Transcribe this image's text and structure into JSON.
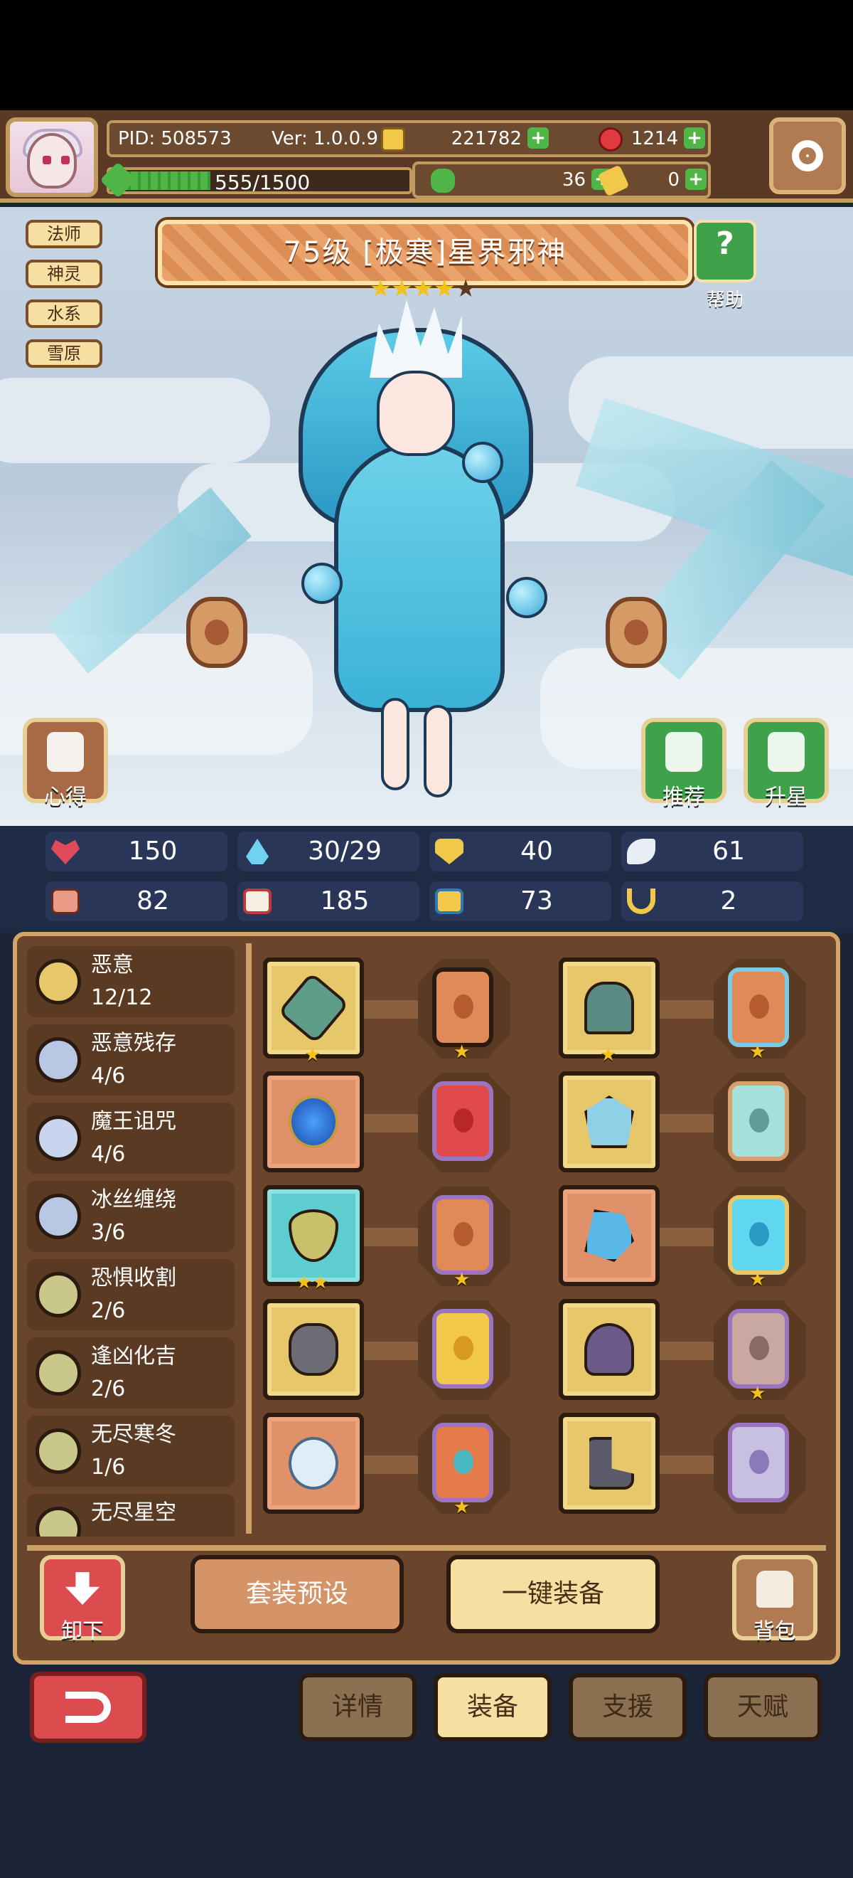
{
  "header": {
    "pid": "PID: 508573",
    "version": "Ver: 1.0.0.9",
    "gold": "221782",
    "gems": "1214",
    "xp": "555/1500",
    "clover": "36",
    "scroll": "0"
  },
  "hero": {
    "tags": [
      "法师",
      "神灵",
      "水系",
      "雪原"
    ],
    "title": "75级  [极寒]星界邪神",
    "stars_filled": 4,
    "stars_total": 5,
    "help_label": "帮助",
    "insight_label": "心得",
    "recommend_label": "推荐",
    "upgrade_label": "升星"
  },
  "stats": [
    {
      "icon": "heart-icon",
      "value": "150"
    },
    {
      "icon": "mana-drop-icon",
      "value": "30/29"
    },
    {
      "icon": "shield-icon",
      "value": "40"
    },
    {
      "icon": "wing-icon",
      "value": "61"
    },
    {
      "icon": "fist-icon",
      "value": "82"
    },
    {
      "icon": "spellbook-icon",
      "value": "185"
    },
    {
      "icon": "magic-shield-icon",
      "value": "73"
    },
    {
      "icon": "horseshoe-icon",
      "value": "2"
    }
  ],
  "sets": [
    {
      "name": "恶意",
      "count": "12/12",
      "color": "#e6c769"
    },
    {
      "name": "恶意残存",
      "count": "4/6",
      "color": "#b8c7e4"
    },
    {
      "name": "魔王诅咒",
      "count": "4/6",
      "color": "#c9d4ee"
    },
    {
      "name": "冰丝缠绕",
      "count": "3/6",
      "color": "#b8c7e4"
    },
    {
      "name": "恐惧收割",
      "count": "2/6",
      "color": "#c9c78a"
    },
    {
      "name": "逢凶化吉",
      "count": "2/6",
      "color": "#c9c78a"
    },
    {
      "name": "无尽寒冬",
      "count": "1/6",
      "color": "#c9c78a"
    },
    {
      "name": "无尽星空",
      "count": "",
      "color": "#c9c78a"
    }
  ],
  "buttons": {
    "unequip": "卸下",
    "preset": "套装预设",
    "auto_equip": "一键装备",
    "bag": "背包"
  },
  "tabs": [
    "详情",
    "装备",
    "支援",
    "天赋"
  ],
  "active_tab": "装备"
}
